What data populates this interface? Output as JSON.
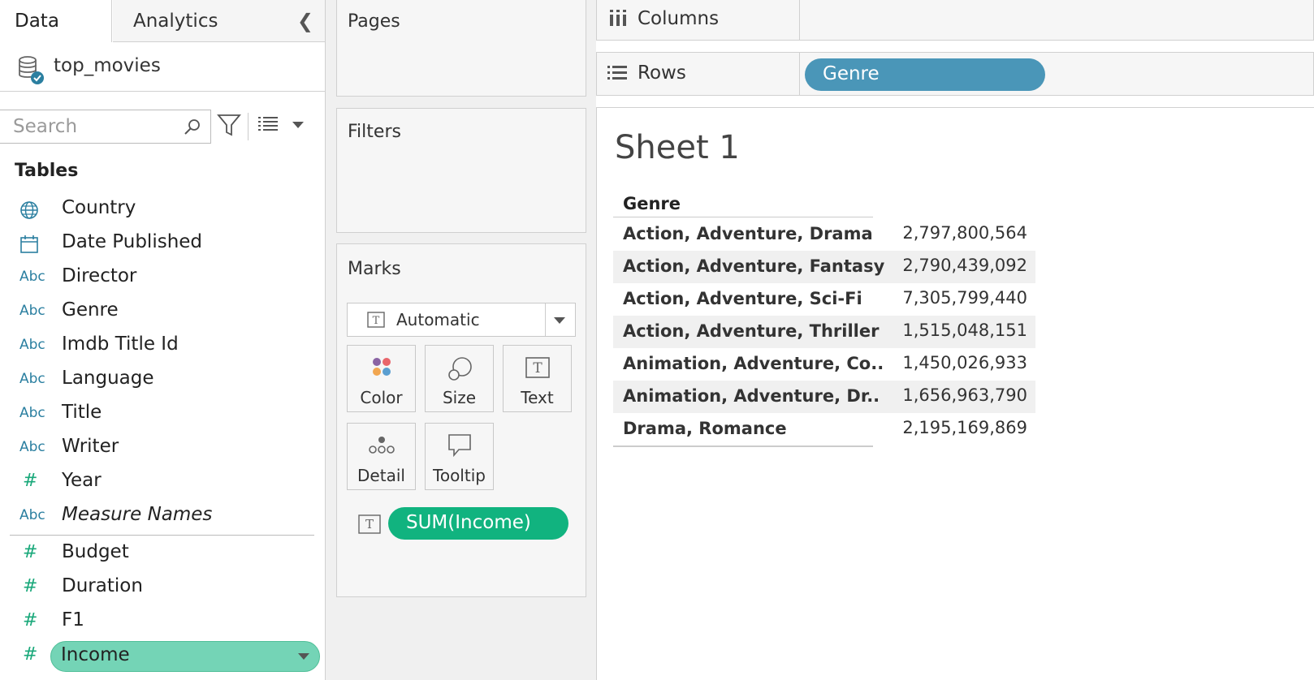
{
  "tabs": {
    "data": "Data",
    "analytics": "Analytics"
  },
  "datasource": {
    "name": "top_movies"
  },
  "search": {
    "placeholder": "Search"
  },
  "tables_heading": "Tables",
  "dimensions": [
    {
      "icon": "globe-icon",
      "glyph": "",
      "label": "Country"
    },
    {
      "icon": "calendar-icon",
      "glyph": "",
      "label": "Date Published"
    },
    {
      "icon": "string-type-icon",
      "glyph": "Abc",
      "label": "Director"
    },
    {
      "icon": "string-type-icon",
      "glyph": "Abc",
      "label": "Genre"
    },
    {
      "icon": "string-type-icon",
      "glyph": "Abc",
      "label": "Imdb Title Id"
    },
    {
      "icon": "string-type-icon",
      "glyph": "Abc",
      "label": "Language"
    },
    {
      "icon": "string-type-icon",
      "glyph": "Abc",
      "label": "Title"
    },
    {
      "icon": "string-type-icon",
      "glyph": "Abc",
      "label": "Writer"
    },
    {
      "icon": "number-type-icon",
      "glyph": "#",
      "label": "Year"
    },
    {
      "icon": "string-type-icon",
      "glyph": "Abc",
      "label": "Measure Names"
    }
  ],
  "measures": [
    {
      "icon": "number-type-icon",
      "glyph": "#",
      "label": "Budget"
    },
    {
      "icon": "number-type-icon",
      "glyph": "#",
      "label": "Duration"
    },
    {
      "icon": "number-type-icon",
      "glyph": "#",
      "label": "F1"
    },
    {
      "icon": "number-type-icon",
      "glyph": "#",
      "label": "Income"
    }
  ],
  "cards": {
    "pages": "Pages",
    "filters": "Filters",
    "marks": "Marks"
  },
  "marks": {
    "type": "Automatic",
    "buttons": {
      "color": "Color",
      "size": "Size",
      "text": "Text",
      "detail": "Detail",
      "tooltip": "Tooltip"
    },
    "text_pill": "SUM(Income)"
  },
  "shelves": {
    "columns": "Columns",
    "rows": "Rows",
    "rows_pill": "Genre"
  },
  "sheet": {
    "title": "Sheet 1",
    "header": "Genre",
    "rows": [
      {
        "genre": "Action, Adventure, Drama",
        "value": "2,797,800,564"
      },
      {
        "genre": "Action, Adventure, Fantasy",
        "value": "2,790,439,092"
      },
      {
        "genre": "Action, Adventure, Sci-Fi",
        "value": "7,305,799,440"
      },
      {
        "genre": "Action, Adventure, Thriller",
        "value": "1,515,048,151"
      },
      {
        "genre": "Animation, Adventure, Co..",
        "value": "1,450,026,933"
      },
      {
        "genre": "Animation, Adventure, Dr..",
        "value": "1,656,963,790"
      },
      {
        "genre": "Drama, Romance",
        "value": "2,195,169,869"
      }
    ]
  },
  "colors": {
    "rows_pill": "#4a96b8",
    "measure_pill": "#11b37f",
    "selected_field": "#74d4b6"
  }
}
